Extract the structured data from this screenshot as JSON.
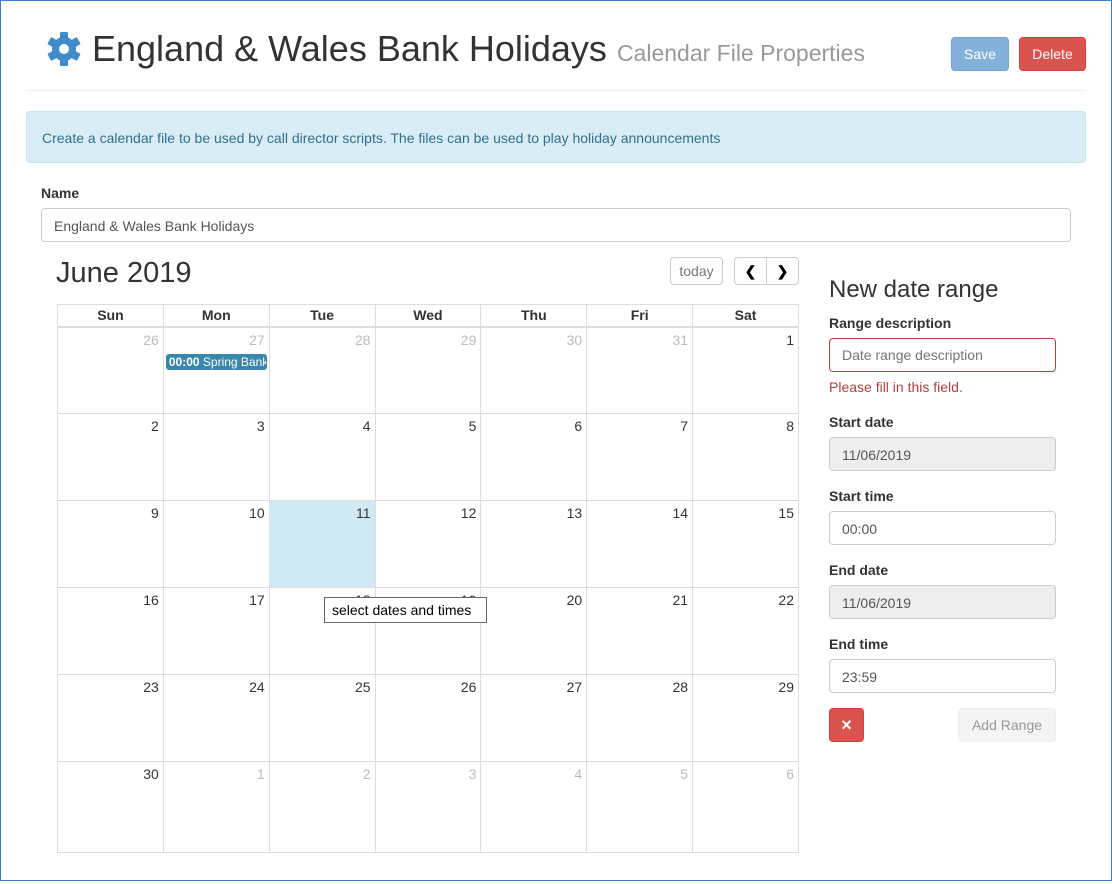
{
  "header": {
    "title": "England & Wales Bank Holidays",
    "subtitle": "Calendar File Properties",
    "save": "Save",
    "delete": "Delete"
  },
  "colors": {
    "primary": "#83b1d9",
    "danger": "#d9534f",
    "info_bg": "#d9edf7",
    "event": "#3a87ad",
    "today": "#d1e8f5"
  },
  "alert": "Create a calendar file to be used by call director scripts. The files can be used to play holiday announcements",
  "name": {
    "label": "Name",
    "value": "England & Wales Bank Holidays"
  },
  "calendar": {
    "title": "June 2019",
    "today": "today",
    "prev_icon": "chevron-left",
    "next_icon": "chevron-right",
    "days": [
      "Sun",
      "Mon",
      "Tue",
      "Wed",
      "Thu",
      "Fri",
      "Sat"
    ],
    "weeks": [
      [
        "26",
        "27",
        "28",
        "29",
        "30",
        "31",
        "1"
      ],
      [
        "2",
        "3",
        "4",
        "5",
        "6",
        "7",
        "8"
      ],
      [
        "9",
        "10",
        "11",
        "12",
        "13",
        "14",
        "15"
      ],
      [
        "16",
        "17",
        "18",
        "19",
        "20",
        "21",
        "22"
      ],
      [
        "23",
        "24",
        "25",
        "26",
        "27",
        "28",
        "29"
      ],
      [
        "30",
        "1",
        "2",
        "3",
        "4",
        "5",
        "6"
      ]
    ],
    "event": {
      "time": "00:00",
      "title": "Spring Bank Holiday"
    },
    "tooltip": "select dates and times"
  },
  "range": {
    "title": "New date range",
    "desc_label": "Range description",
    "desc_placeholder": "Date range description",
    "error": "Please fill in this field.",
    "start_date_label": "Start date",
    "start_date": "11/06/2019",
    "start_time_label": "Start time",
    "start_time": "00:00",
    "end_date_label": "End date",
    "end_date": "11/06/2019",
    "end_time_label": "End time",
    "end_time": "23:59",
    "add": "Add Range",
    "remove": "×"
  }
}
